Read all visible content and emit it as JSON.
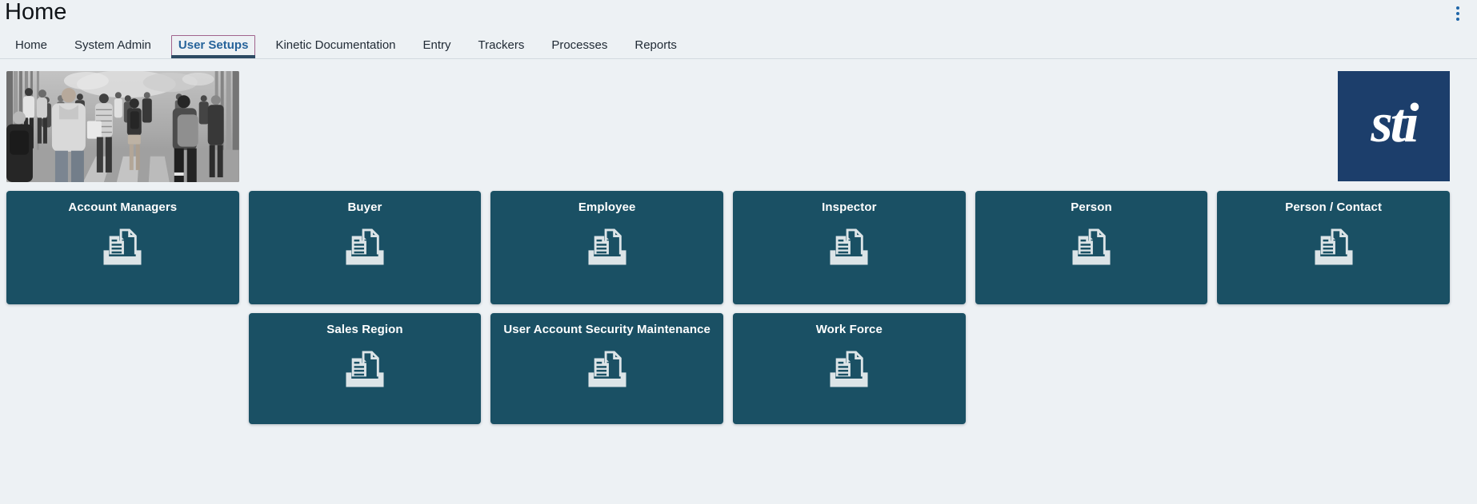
{
  "header": {
    "title": "Home",
    "menu_icon": "vertical-ellipsis-icon"
  },
  "tabs": {
    "items": [
      {
        "label": "Home",
        "active": false
      },
      {
        "label": "System Admin",
        "active": false
      },
      {
        "label": "User Setups",
        "active": true
      },
      {
        "label": "Kinetic Documentation",
        "active": false
      },
      {
        "label": "Entry",
        "active": false
      },
      {
        "label": "Trackers",
        "active": false
      },
      {
        "label": "Processes",
        "active": false
      },
      {
        "label": "Reports",
        "active": false
      }
    ]
  },
  "branding": {
    "logo_text": "sti",
    "photo_alt": "black and white photo of pedestrians walking on a busy street"
  },
  "tiles": {
    "icon": "stacked-documents-in-tray-icon",
    "items": [
      {
        "label": "Account Managers"
      },
      {
        "label": "Buyer"
      },
      {
        "label": "Employee"
      },
      {
        "label": "Inspector"
      },
      {
        "label": "Person"
      },
      {
        "label": "Person / Contact"
      },
      {
        "label": "Sales Region"
      },
      {
        "label": "User Account Security Maintenance"
      },
      {
        "label": "Work Force"
      }
    ]
  },
  "colors": {
    "page_bg": "#edf1f4",
    "title_text": "#101418",
    "tab_text": "#212b36",
    "tab_active": "#26639a",
    "tab_underline": "#2d4a63",
    "focus_ring": "#a1648c",
    "divider": "#d3d9df",
    "kebab": "#2066a8",
    "tile_bg": "#1a5064",
    "tile_text": "#ffffff",
    "icon_light": "#dce4e7",
    "logo_bg": "#1c3e6b",
    "logo_text": "#ffffff"
  }
}
